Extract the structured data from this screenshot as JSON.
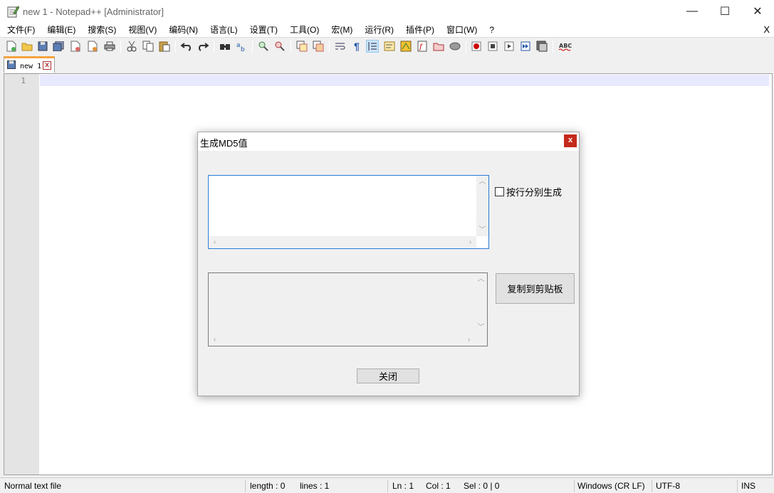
{
  "window": {
    "title": "new 1 - Notepad++ [Administrator]",
    "minimize_glyph": "—",
    "maximize_glyph": "☐",
    "close_glyph": "✕"
  },
  "menu": {
    "items": [
      "文件(F)",
      "编辑(E)",
      "搜索(S)",
      "视图(V)",
      "编码(N)",
      "语言(L)",
      "设置(T)",
      "工具(O)",
      "宏(M)",
      "运行(R)",
      "插件(P)",
      "窗口(W)",
      "?"
    ],
    "close_doc": "X"
  },
  "tab": {
    "label": "new 1",
    "close": "x"
  },
  "editor": {
    "line_number": "1"
  },
  "status": {
    "file_type": "Normal text file",
    "length": "length : 0",
    "lines": "lines : 1",
    "ln": "Ln : 1",
    "col": "Col : 1",
    "sel": "Sel : 0 | 0",
    "eol": "Windows (CR LF)",
    "encoding": "UTF-8",
    "mode": "INS"
  },
  "dialog": {
    "title": "生成MD5值",
    "close": "x",
    "checkbox_label": "按行分别生成",
    "copy_button": "复制到剪贴板",
    "close_button": "关闭",
    "input_value": "",
    "output_value": ""
  },
  "colors": {
    "tab_accent": "#f5a441",
    "caret_line": "#e8e8ff",
    "dialog_close_bg": "#c42b1c",
    "focus_border": "#2b7ad6"
  }
}
